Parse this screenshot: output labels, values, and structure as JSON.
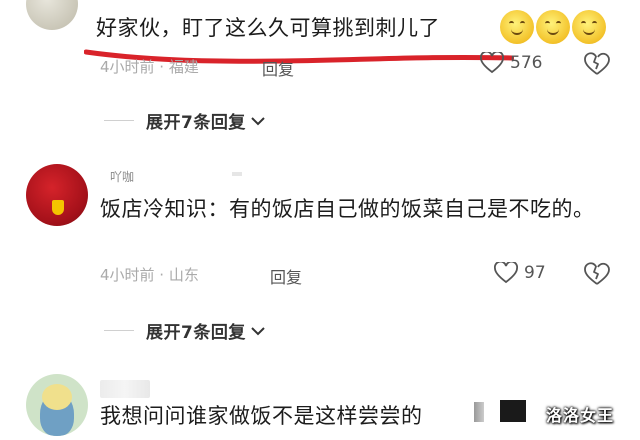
{
  "comments": [
    {
      "text": "好家伙，盯了这么久可算挑到刺儿了",
      "emojis": [
        "smile-emoji",
        "smile-emoji",
        "smile-emoji"
      ],
      "meta": "4小时前 · 福建",
      "reply_label": "回复",
      "like_count": "576"
    },
    {
      "username": "吖咖",
      "text": "饭店冷知识：有的饭店自己做的饭菜自己是不吃的。",
      "meta": "4小时前 · 山东",
      "reply_label": "回复",
      "like_count": "97"
    },
    {
      "text": "我想问问谁家做饭不是这样尝尝的"
    }
  ],
  "expand_replies": [
    {
      "label": "展开7条回复"
    },
    {
      "label": "展开7条回复"
    }
  ],
  "watermark": "洛洛女王",
  "colors": {
    "annotation_red": "#d9232a",
    "meta_gray": "#aaaaaa",
    "icon_gray": "#555555"
  },
  "icons": {
    "like": "heart-outline-icon",
    "dislike": "broken-heart-icon",
    "expand": "chevron-down-icon"
  }
}
